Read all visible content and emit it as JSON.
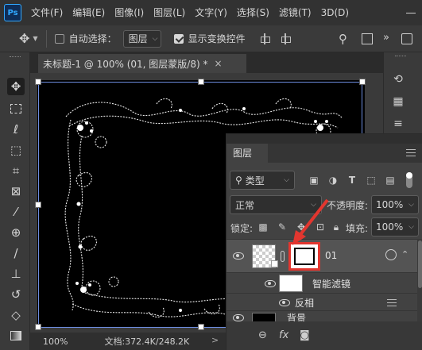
{
  "app": {
    "logo": "Ps"
  },
  "menu": [
    "文件(F)",
    "编辑(E)",
    "图像(I)",
    "图层(L)",
    "文字(Y)",
    "选择(S)",
    "滤镜(T)",
    "3D(D)"
  ],
  "options": {
    "auto_select_label": "自动选择：",
    "auto_select_checked": false,
    "auto_select_target": "图层",
    "show_transform_label": "显示变换控件",
    "show_transform_checked": true
  },
  "document_tab": {
    "title": "未标题-1 @ 100% (01, 图层蒙版/8) *",
    "close": "×"
  },
  "status": {
    "zoom": "100%",
    "doc_info": "文档:372.4K/248.2K",
    "arrow": ">"
  },
  "layers_panel": {
    "title": "图层",
    "filter_label": "类型",
    "blend_mode": "正常",
    "opacity_label": "不透明度:",
    "opacity_value": "100%",
    "lock_label": "锁定:",
    "fill_label": "填充:",
    "fill_value": "100%",
    "layers": [
      {
        "name": "01",
        "selected": true
      },
      {
        "name": "智能滤镜"
      },
      {
        "name": "反相"
      },
      {
        "name": "背景"
      }
    ],
    "bottom_fx": "fx"
  },
  "colors": {
    "accent_red": "#e2362f",
    "panel": "#424242",
    "canvas": "#000000"
  }
}
